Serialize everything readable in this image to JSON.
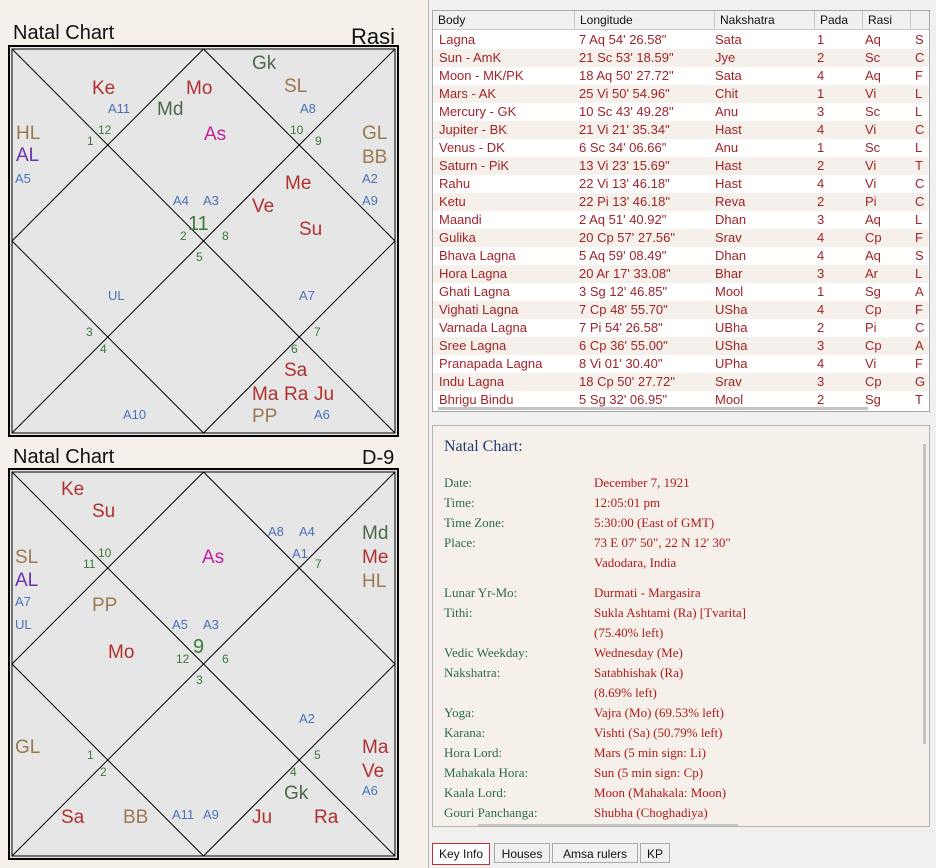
{
  "rasi_chart": {
    "title": "Natal Chart",
    "tag": "Rasi",
    "items": [
      {
        "id": "ke",
        "text": "Ke",
        "color": "#b03030",
        "type": "planet"
      },
      {
        "id": "mo",
        "text": "Mo",
        "color": "#b03030",
        "type": "planet"
      },
      {
        "id": "gk",
        "text": "Gk",
        "color": "#4a6a4a",
        "type": "planet"
      },
      {
        "id": "sl",
        "text": "SL",
        "color": "#9a7a50",
        "type": "planet"
      },
      {
        "id": "md",
        "text": "Md",
        "color": "#4a6a4a",
        "type": "planet"
      },
      {
        "id": "as",
        "text": "As",
        "color": "#c020a0",
        "type": "planet"
      },
      {
        "id": "hl",
        "text": "HL",
        "color": "#9a7a50",
        "type": "planet"
      },
      {
        "id": "al",
        "text": "AL",
        "color": "#6a30b0",
        "type": "planet"
      },
      {
        "id": "gl",
        "text": "GL",
        "color": "#9a7a50",
        "type": "planet"
      },
      {
        "id": "bb",
        "text": "BB",
        "color": "#9a7a50",
        "type": "planet"
      },
      {
        "id": "me",
        "text": "Me",
        "color": "#b03030",
        "type": "planet"
      },
      {
        "id": "ve",
        "text": "Ve",
        "color": "#b03030",
        "type": "planet"
      },
      {
        "id": "su",
        "text": "Su",
        "color": "#b03030",
        "type": "planet"
      },
      {
        "id": "sa",
        "text": "Sa",
        "color": "#b03030",
        "type": "planet"
      },
      {
        "id": "ma",
        "text": "Ma",
        "color": "#b03030",
        "type": "planet"
      },
      {
        "id": "ra",
        "text": "Ra",
        "color": "#b03030",
        "type": "planet"
      },
      {
        "id": "ju",
        "text": "Ju",
        "color": "#b03030",
        "type": "planet"
      },
      {
        "id": "pp",
        "text": "PP",
        "color": "#9a7a50",
        "type": "planet"
      },
      {
        "id": "a11",
        "text": "A11",
        "type": "arud"
      },
      {
        "id": "a8",
        "text": "A8",
        "type": "arud"
      },
      {
        "id": "a5",
        "text": "A5",
        "type": "arud"
      },
      {
        "id": "a2",
        "text": "A2",
        "type": "arud"
      },
      {
        "id": "a9",
        "text": "A9",
        "type": "arud"
      },
      {
        "id": "a4",
        "text": "A4",
        "type": "arud"
      },
      {
        "id": "a3",
        "text": "A3",
        "type": "arud"
      },
      {
        "id": "ul",
        "text": "UL",
        "type": "arud"
      },
      {
        "id": "a7",
        "text": "A7",
        "type": "arud"
      },
      {
        "id": "a10",
        "text": "A10",
        "type": "arud"
      },
      {
        "id": "a6",
        "text": "A6",
        "type": "arud"
      },
      {
        "id": "n12",
        "text": "12",
        "type": "num"
      },
      {
        "id": "n1",
        "text": "1",
        "type": "num"
      },
      {
        "id": "n10",
        "text": "10",
        "type": "num"
      },
      {
        "id": "n9",
        "text": "9",
        "type": "num"
      },
      {
        "id": "n11",
        "text": "11",
        "type": "sign"
      },
      {
        "id": "n2",
        "text": "2",
        "type": "num"
      },
      {
        "id": "n8",
        "text": "8",
        "type": "num"
      },
      {
        "id": "n5",
        "text": "5",
        "type": "num"
      },
      {
        "id": "n3",
        "text": "3",
        "type": "num"
      },
      {
        "id": "n4",
        "text": "4",
        "type": "num"
      },
      {
        "id": "n6",
        "text": "6",
        "type": "num"
      },
      {
        "id": "n7",
        "text": "7",
        "type": "num"
      }
    ]
  },
  "navamsa_chart": {
    "title": "Natal Chart",
    "tag": "D-9",
    "items": [
      {
        "id": "ke",
        "text": "Ke",
        "color": "#b03030",
        "type": "planet"
      },
      {
        "id": "su",
        "text": "Su",
        "color": "#b03030",
        "type": "planet"
      },
      {
        "id": "as",
        "text": "As",
        "color": "#c020a0",
        "type": "planet"
      },
      {
        "id": "md",
        "text": "Md",
        "color": "#4a6a4a",
        "type": "planet"
      },
      {
        "id": "me",
        "text": "Me",
        "color": "#b03030",
        "type": "planet"
      },
      {
        "id": "hl",
        "text": "HL",
        "color": "#9a7a50",
        "type": "planet"
      },
      {
        "id": "sl",
        "text": "SL",
        "color": "#9a7a50",
        "type": "planet"
      },
      {
        "id": "al",
        "text": "AL",
        "color": "#6a30b0",
        "type": "planet"
      },
      {
        "id": "pp",
        "text": "PP",
        "color": "#9a7a50",
        "type": "planet"
      },
      {
        "id": "mo",
        "text": "Mo",
        "color": "#b03030",
        "type": "planet"
      },
      {
        "id": "gl",
        "text": "GL",
        "color": "#9a7a50",
        "type": "planet"
      },
      {
        "id": "ma",
        "text": "Ma",
        "color": "#b03030",
        "type": "planet"
      },
      {
        "id": "ve",
        "text": "Ve",
        "color": "#b03030",
        "type": "planet"
      },
      {
        "id": "gk",
        "text": "Gk",
        "color": "#4a6a4a",
        "type": "planet"
      },
      {
        "id": "sa",
        "text": "Sa",
        "color": "#b03030",
        "type": "planet"
      },
      {
        "id": "bb",
        "text": "BB",
        "color": "#9a7a50",
        "type": "planet"
      },
      {
        "id": "ju",
        "text": "Ju",
        "color": "#b03030",
        "type": "planet"
      },
      {
        "id": "ra",
        "text": "Ra",
        "color": "#b03030",
        "type": "planet"
      },
      {
        "id": "a8",
        "text": "A8",
        "type": "arud"
      },
      {
        "id": "a4",
        "text": "A4",
        "type": "arud"
      },
      {
        "id": "a1",
        "text": "A1",
        "type": "arud"
      },
      {
        "id": "a7",
        "text": "A7",
        "type": "arud"
      },
      {
        "id": "ul",
        "text": "UL",
        "type": "arud"
      },
      {
        "id": "a5",
        "text": "A5",
        "type": "arud"
      },
      {
        "id": "a3",
        "text": "A3",
        "type": "arud"
      },
      {
        "id": "a2",
        "text": "A2",
        "type": "arud"
      },
      {
        "id": "a6",
        "text": "A6",
        "type": "arud"
      },
      {
        "id": "a11",
        "text": "A11",
        "type": "arud"
      },
      {
        "id": "a9",
        "text": "A9",
        "type": "arud"
      },
      {
        "id": "n10",
        "text": "10",
        "type": "num"
      },
      {
        "id": "n11",
        "text": "11",
        "type": "num"
      },
      {
        "id": "n7",
        "text": "7",
        "type": "num"
      },
      {
        "id": "n9",
        "text": "9",
        "type": "sign"
      },
      {
        "id": "n12",
        "text": "12",
        "type": "num"
      },
      {
        "id": "n6",
        "text": "6",
        "type": "num"
      },
      {
        "id": "n3",
        "text": "3",
        "type": "num"
      },
      {
        "id": "n1",
        "text": "1",
        "type": "num"
      },
      {
        "id": "n2",
        "text": "2",
        "type": "num"
      },
      {
        "id": "n5",
        "text": "5",
        "type": "num"
      },
      {
        "id": "n4",
        "text": "4",
        "type": "num"
      }
    ]
  },
  "table": {
    "columns": [
      "Body",
      "Longitude",
      "Nakshatra",
      "Pada",
      "Rasi",
      ""
    ],
    "rows": [
      [
        "Lagna",
        "7 Aq 54' 26.58\"",
        "Sata",
        "1",
        "Aq",
        "S"
      ],
      [
        "Sun - AmK",
        "21 Sc 53' 18.59\"",
        "Jye",
        "2",
        "Sc",
        "C"
      ],
      [
        "Moon - MK/PK",
        "18 Aq 50' 27.72\"",
        "Sata",
        "4",
        "Aq",
        "F"
      ],
      [
        "Mars - AK",
        "25 Vi 50' 54.96\"",
        "Chit",
        "1",
        "Vi",
        "L"
      ],
      [
        "Mercury - GK",
        "10 Sc 43' 49.28\"",
        "Anu",
        "3",
        "Sc",
        "L"
      ],
      [
        "Jupiter - BK",
        "21 Vi 21' 35.34\"",
        "Hast",
        "4",
        "Vi",
        "C"
      ],
      [
        "Venus - DK",
        "6 Sc 34' 06.66\"",
        "Anu",
        "1",
        "Sc",
        "L"
      ],
      [
        "Saturn - PiK",
        "13 Vi 23' 15.69\"",
        "Hast",
        "2",
        "Vi",
        "T"
      ],
      [
        "Rahu",
        "22 Vi 13' 46.18\"",
        "Hast",
        "4",
        "Vi",
        "C"
      ],
      [
        "Ketu",
        "22 Pi 13' 46.18\"",
        "Reva",
        "2",
        "Pi",
        "C"
      ],
      [
        "Maandi",
        "2 Aq 51' 40.92\"",
        "Dhan",
        "3",
        "Aq",
        "L"
      ],
      [
        "Gulika",
        "20 Cp 57' 27.56\"",
        "Srav",
        "4",
        "Cp",
        "F"
      ],
      [
        "Bhava Lagna",
        "5 Aq 59' 08.49\"",
        "Dhan",
        "4",
        "Aq",
        "S"
      ],
      [
        "Hora Lagna",
        "20 Ar 17' 33.08\"",
        "Bhar",
        "3",
        "Ar",
        "L"
      ],
      [
        "Ghati Lagna",
        "3 Sg 12' 46.85\"",
        "Mool",
        "1",
        "Sg",
        "A"
      ],
      [
        "Vighati Lagna",
        "7 Cp 48' 55.70\"",
        "USha",
        "4",
        "Cp",
        "F"
      ],
      [
        "Varnada Lagna",
        "7 Pi 54' 26.58\"",
        "UBha",
        "2",
        "Pi",
        "C"
      ],
      [
        "Sree Lagna",
        "6 Cp 36' 55.00\"",
        "USha",
        "3",
        "Cp",
        "A"
      ],
      [
        "Pranapada Lagna",
        "8 Vi 01' 30.40\"",
        "UPha",
        "4",
        "Vi",
        "F"
      ],
      [
        "Indu Lagna",
        "18 Cp 50' 27.72\"",
        "Srav",
        "3",
        "Cp",
        "G"
      ],
      [
        "Bhrigu Bindu",
        "5 Sg 32' 06.95\"",
        "Mool",
        "2",
        "Sg",
        "T"
      ]
    ]
  },
  "info": {
    "title": "Natal Chart:",
    "lines": [
      {
        "k": "Date:",
        "v": "December 7, 1921"
      },
      {
        "k": "Time:",
        "v": "12:05:01 pm"
      },
      {
        "k": "Time Zone:",
        "v": "5:30:00 (East of GMT)"
      },
      {
        "k": "Place:",
        "v": "73 E 07' 50\", 22 N 12' 30\""
      },
      {
        "k": "",
        "v": "Vadodara, India"
      },
      {
        "k": "Lunar Yr-Mo:",
        "v": "Durmati - Margasira"
      },
      {
        "k": "Tithi:",
        "v": "Sukla Ashtami (Ra) [Tvarita]"
      },
      {
        "k": "",
        "v": "  (75.40% left)"
      },
      {
        "k": "Vedic Weekday:",
        "v": "Wednesday (Me)"
      },
      {
        "k": "Nakshatra:",
        "v": "Satabhishak (Ra)"
      },
      {
        "k": "",
        "v": "  (8.69% left)"
      },
      {
        "k": "Yoga:",
        "v": "Vajra (Mo) (69.53% left)"
      },
      {
        "k": "Karana:",
        "v": "Vishti (Sa) (50.79% left)"
      },
      {
        "k": "Hora Lord:",
        "v": "Mars (5 min sign: Li)"
      },
      {
        "k": "Mahakala Hora:",
        "v": "Sun (5 min sign: Cp)"
      },
      {
        "k": "Kaala Lord:",
        "v": "Moon (Mahakala: Moon)"
      },
      {
        "k": "Gouri Panchanga:",
        "v": "Shubha (Choghadiya)"
      }
    ]
  },
  "tabs": [
    "Key Info",
    "Houses",
    "Amsa rulers",
    "KP"
  ],
  "active_tab": 0
}
